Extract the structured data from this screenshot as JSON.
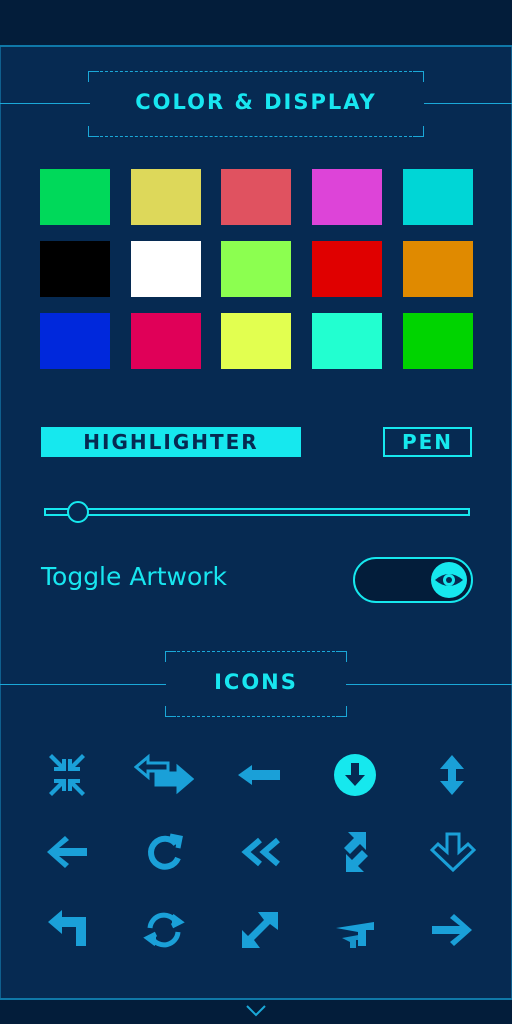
{
  "header": {
    "title": "COLOR & DISPLAY"
  },
  "colors": {
    "accent": "#16e8ee",
    "background": "#062a52",
    "icon": "#1aa0d8",
    "swatches": [
      "#00d95a",
      "#ddd85a",
      "#e05260",
      "#dd44d8",
      "#00d6d6",
      "#000000",
      "#ffffff",
      "#8cff50",
      "#e00000",
      "#e08a00",
      "#0028dc",
      "#e00058",
      "#e2ff50",
      "#22ffd0",
      "#00d400"
    ]
  },
  "tools": {
    "highlighter_label": "HIGHLIGHTER",
    "pen_label": "PEN",
    "size_slider_value": 0.06
  },
  "artwork": {
    "toggle_label": "Toggle Artwork",
    "toggle_on": true
  },
  "icons_section": {
    "title": "ICONS",
    "icons": [
      "compress-arrows-icon",
      "exchange-arrows-icon",
      "arrow-left-bold-icon",
      "download-circle-icon",
      "resize-vertical-icon",
      "arrow-left-icon",
      "refresh-icon",
      "double-chevron-left-icon",
      "swap-vertical-icon",
      "arrow-down-outline-icon",
      "turn-left-icon",
      "sync-icon",
      "expand-diagonal-icon",
      "upward-chevrons-icon",
      "arrow-right-icon"
    ]
  },
  "footer": {
    "icon": "chevron-down-icon"
  }
}
